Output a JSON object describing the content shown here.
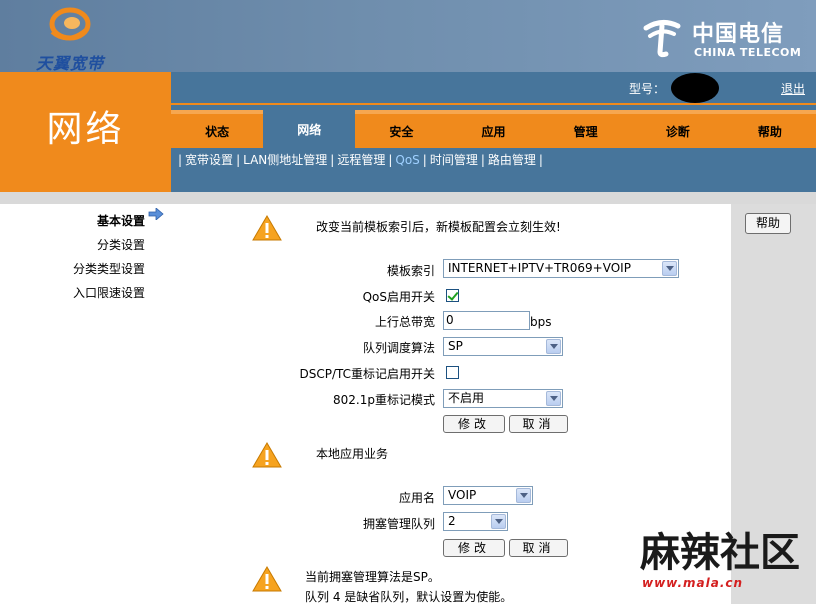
{
  "header": {
    "brand_left": "天翼宽带",
    "brand_right_cn": "中国电信",
    "brand_right_en": "CHINA TELECOM"
  },
  "section_title": "网络",
  "model": {
    "label": "型号：",
    "logout": "退出"
  },
  "tabs": [
    {
      "label": "状态"
    },
    {
      "label": "网络",
      "active": true
    },
    {
      "label": "安全"
    },
    {
      "label": "应用"
    },
    {
      "label": "管理"
    },
    {
      "label": "诊断"
    },
    {
      "label": "帮助"
    }
  ],
  "subnav": [
    {
      "label": "宽带设置"
    },
    {
      "label": "LAN侧地址管理"
    },
    {
      "label": "远程管理"
    },
    {
      "label": "QoS",
      "active": true
    },
    {
      "label": "时间管理"
    },
    {
      "label": "路由管理"
    }
  ],
  "left_menu": [
    {
      "label": "基本设置",
      "active": true
    },
    {
      "label": "分类设置"
    },
    {
      "label": "分类类型设置"
    },
    {
      "label": "入口限速设置"
    }
  ],
  "help_button": "帮助",
  "notice1": "改变当前模板索引后，新模板配置会立刻生效!",
  "form": {
    "template_label": "模板索引",
    "template_value": "INTERNET+IPTV+TR069+VOIP",
    "qos_label": "QoS启用开关",
    "qos_checked": true,
    "uplink_label": "上行总带宽",
    "uplink_value": "0",
    "uplink_unit": "bps",
    "scheduler_label": "队列调度算法",
    "scheduler_value": "SP",
    "dscp_label": "DSCP/TC重标记启用开关",
    "dscp_checked": false,
    "p8021_label": "802.1p重标记模式",
    "p8021_value": "不启用",
    "modify_button": "修改",
    "cancel_button": "取消"
  },
  "notice2": "本地应用业务",
  "app_form": {
    "app_label": "应用名",
    "app_value": "VOIP",
    "queue_label": "拥塞管理队列",
    "queue_value": "2",
    "modify_button": "修改",
    "cancel_button": "取消"
  },
  "notice3_line1": "当前拥塞管理算法是SP。",
  "notice3_line2": "队列 4 是缺省队列，默认设置为使能。",
  "watermark": {
    "text": "麻辣社区",
    "url": "www.mala.cn"
  },
  "colors": {
    "orange": "#f08a1c",
    "nav_blue": "#47759b",
    "header_blue": "#6f8ead"
  }
}
